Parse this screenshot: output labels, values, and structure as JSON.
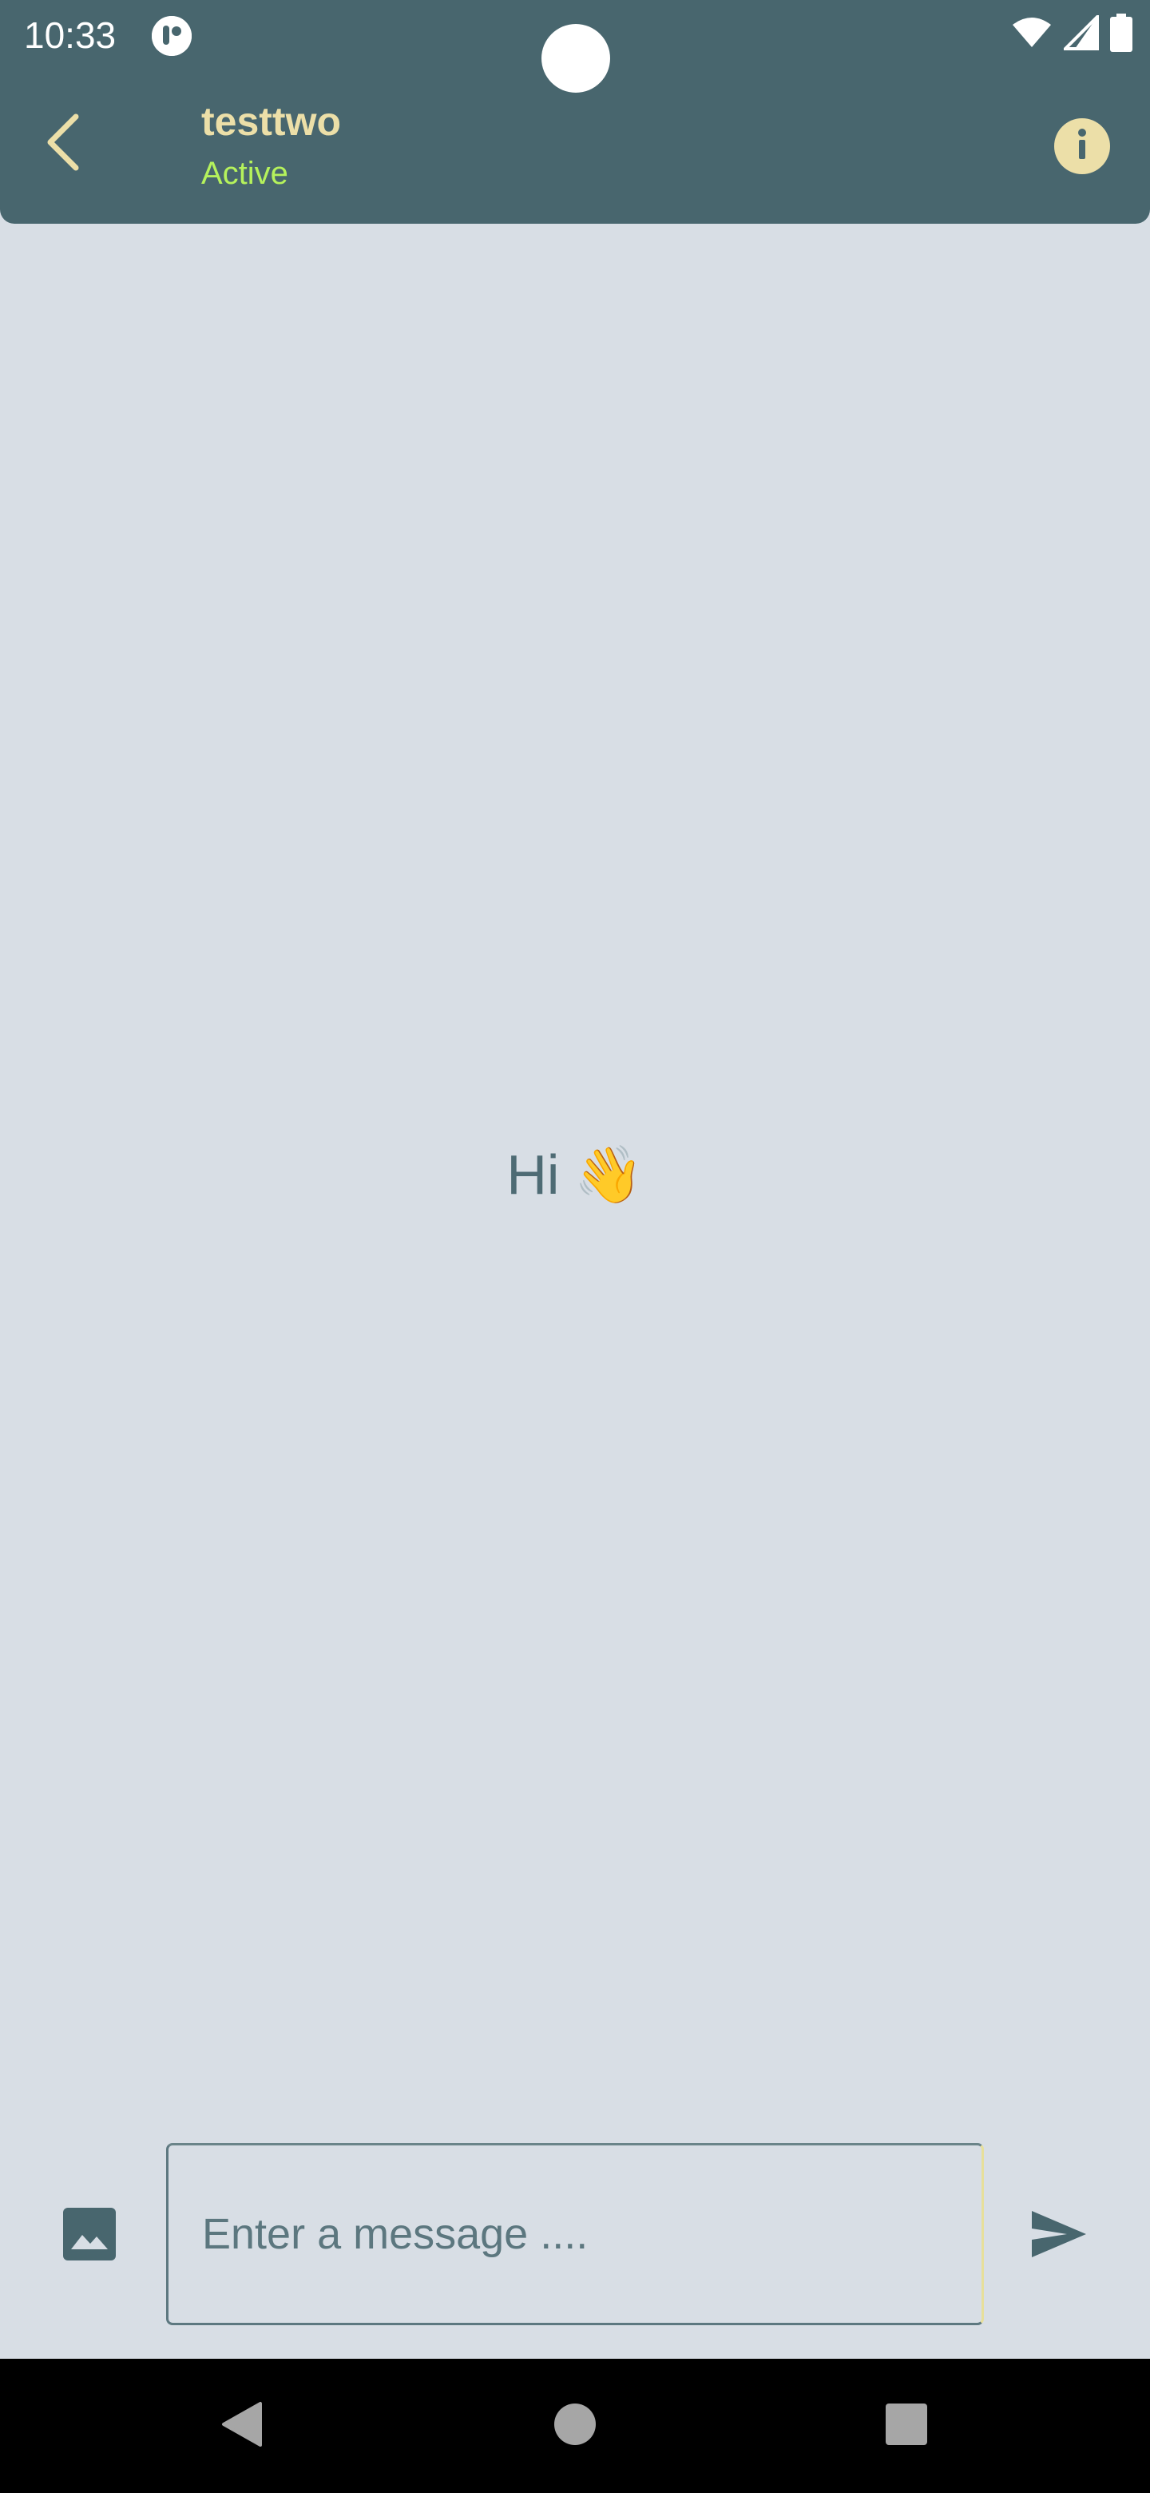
{
  "status_bar": {
    "time": "10:33"
  },
  "header": {
    "contact_name": "testtwo",
    "contact_status": "Active"
  },
  "chat": {
    "greeting_text": "Hi",
    "greeting_emoji": "👋"
  },
  "composer": {
    "placeholder": "Enter a message ....",
    "value": ""
  },
  "icons": {
    "back": "chevron-left-icon",
    "info": "info-icon",
    "image": "image-icon",
    "send": "send-icon",
    "nav_back": "triangle-back-icon",
    "nav_home": "circle-home-icon",
    "nav_recents": "square-recents-icon"
  },
  "colors": {
    "header_bg": "#48666e",
    "accent_yellow": "#ecdfa8",
    "active_green": "#b5f25c",
    "chat_bg": "#d8dee5",
    "icon_slate": "#48666e"
  }
}
